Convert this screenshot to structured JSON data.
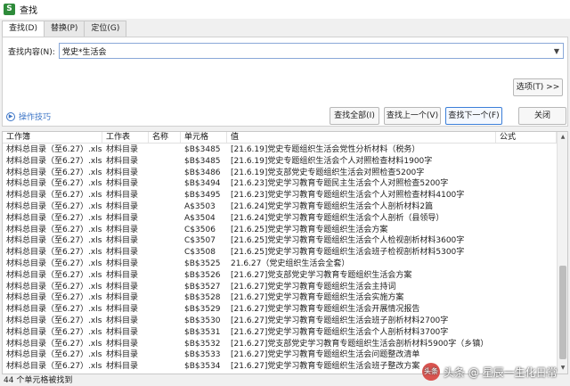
{
  "window": {
    "title": "查找",
    "app_icon_letter": "S"
  },
  "tabs": [
    {
      "label": "查找(D)"
    },
    {
      "label": "替换(P)"
    },
    {
      "label": "定位(G)"
    }
  ],
  "find": {
    "label": "查找内容(N):",
    "value": "党史*生活会"
  },
  "buttons": {
    "options": "选项(T) >>",
    "find_all": "查找全部(I)",
    "find_prev": "查找上一个(V)",
    "find_next": "查找下一个(F)",
    "close": "关闭"
  },
  "tips": {
    "label": "操作技巧"
  },
  "table": {
    "columns": [
      "工作簿",
      "工作表",
      "名称",
      "单元格",
      "值",
      "公式"
    ],
    "rows": [
      [
        "材料总目录（至6.27）.xls",
        "材料目录",
        "",
        "$B$3485",
        "[21.6.19]党史专题组织生活会党性分析材料（税务）"
      ],
      [
        "材料总目录（至6.27）.xls",
        "材料目录",
        "",
        "$B$3485",
        "[21.6.19]党史专题组织生活会个人对照检查材料1900字"
      ],
      [
        "材料总目录（至6.27）.xls",
        "材料目录",
        "",
        "$B$3486",
        "[21.6.19]党支部党史专题组织生活会对照检查5200字"
      ],
      [
        "材料总目录（至6.27）.xls",
        "材料目录",
        "",
        "$B$3494",
        "[21.6.23]党史学习教育专题民主生活会个人对照检查5200字"
      ],
      [
        "材料总目录（至6.27）.xls",
        "材料目录",
        "",
        "$B$3495",
        "[21.6.23]党史学习教育专题组织生活会个人对照检查材料4100字"
      ],
      [
        "材料总目录（至6.27）.xls",
        "材料目录",
        "",
        "A$3503",
        "[21.6.24]党史学习教育专题组织生活会个人剖析材料2篇"
      ],
      [
        "材料总目录（至6.27）.xls",
        "材料目录",
        "",
        "A$3504",
        "[21.6.24]党史学习教育专题组织生活会个人剖析（县领导）"
      ],
      [
        "材料总目录（至6.27）.xls",
        "材料目录",
        "",
        "C$3506",
        "[21.6.25]党史学习教育专题组织生活会方案"
      ],
      [
        "材料总目录（至6.27）.xls",
        "材料目录",
        "",
        "C$3507",
        "[21.6.25]党史学习教育专题组织生活会个人检视剖析材料3600字"
      ],
      [
        "材料总目录（至6.27）.xls",
        "材料目录",
        "",
        "C$3508",
        "[21.6.25]党史学习教育专题组织生活会班子检视剖析材料5300字"
      ],
      [
        "材料总目录（至6.27）.xls",
        "材料目录",
        "",
        "$B$3525",
        "21.6.27（党史组织生活会全套）"
      ],
      [
        "材料总目录（至6.27）.xls",
        "材料目录",
        "",
        "$B$3526",
        "[21.6.27]党支部党史学习教育专题组织生活会方案"
      ],
      [
        "材料总目录（至6.27）.xls",
        "材料目录",
        "",
        "$B$3527",
        "[21.6.27]党史学习教育专题组织生活会主持词"
      ],
      [
        "材料总目录（至6.27）.xls",
        "材料目录",
        "",
        "$B$3528",
        "[21.6.27]党史学习教育专题组织生活会实施方案"
      ],
      [
        "材料总目录（至6.27）.xls",
        "材料目录",
        "",
        "$B$3529",
        "[21.6.27]党史学习教育专题组织生活会开展情况报告"
      ],
      [
        "材料总目录（至6.27）.xls",
        "材料目录",
        "",
        "$B$3530",
        "[21.6.27]党史学习教育专题组织生活会班子剖析材料2700字"
      ],
      [
        "材料总目录（至6.27）.xls",
        "材料目录",
        "",
        "$B$3531",
        "[21.6.27]党史学习教育专题组织生活会个人剖析材料3700字"
      ],
      [
        "材料总目录（至6.27）.xls",
        "材料目录",
        "",
        "$B$3532",
        "[21.6.27]党支部党史学习教育专题组织生活会剖析材料5900字（乡镇）"
      ],
      [
        "材料总目录（至6.27）.xls",
        "材料目录",
        "",
        "$B$3533",
        "[21.6.27]党史学习教育专题组织生活会问题整改清单"
      ],
      [
        "材料总目录（至6.27）.xls",
        "材料目录",
        "",
        "$B$3534",
        "[21.6.27]党史学习教育专题组织生活会班子整改方案"
      ]
    ]
  },
  "status": {
    "text": "44 个单元格被找到"
  },
  "watermark": {
    "text": "头条 @ 星辰一生化日常"
  }
}
